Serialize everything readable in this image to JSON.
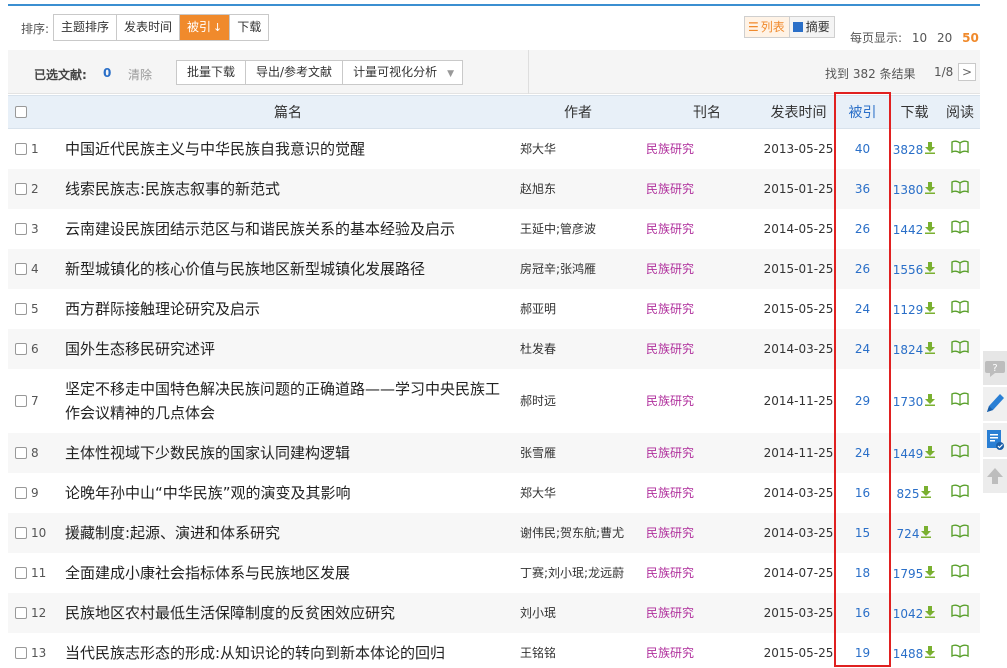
{
  "sortbar": {
    "label": "排序:",
    "options": [
      {
        "label": "主题排序"
      },
      {
        "label": "发表时间"
      },
      {
        "label": "被引",
        "arrow": "↓"
      },
      {
        "label": "下载"
      }
    ],
    "view_list": "列表",
    "view_abstract": "摘要",
    "perpage_label": "每页显示:",
    "perpage_options": [
      "10",
      "20",
      "50"
    ],
    "perpage_selected": "50"
  },
  "selbar": {
    "selected_label": "已选文献:",
    "selected_count": "0",
    "clear": "清除",
    "actions": [
      "批量下载",
      "导出/参考文献",
      "计量可视化分析"
    ],
    "result_count": "找到 382 条结果",
    "page_indicator": "1/8",
    "next": ">"
  },
  "table": {
    "headers": {
      "title": "篇名",
      "author": "作者",
      "journal": "刊名",
      "date": "发表时间",
      "cite": "被引",
      "download": "下载",
      "read": "阅读"
    },
    "rows": [
      {
        "num": "1",
        "title": "中国近代民族主义与中华民族自我意识的觉醒",
        "author": "郑大华",
        "journal": "民族研究",
        "date": "2013-05-25",
        "cite": "40",
        "download": "3828"
      },
      {
        "num": "2",
        "title": "线索民族志:民族志叙事的新范式",
        "author": "赵旭东",
        "journal": "民族研究",
        "date": "2015-01-25",
        "cite": "36",
        "download": "1380"
      },
      {
        "num": "3",
        "title": "云南建设民族团结示范区与和谐民族关系的基本经验及启示",
        "author": "王延中;管彦波",
        "journal": "民族研究",
        "date": "2014-05-25",
        "cite": "26",
        "download": "1442"
      },
      {
        "num": "4",
        "title": "新型城镇化的核心价值与民族地区新型城镇化发展路径",
        "author": "房冠辛;张鸿雁",
        "journal": "民族研究",
        "date": "2015-01-25",
        "cite": "26",
        "download": "1556"
      },
      {
        "num": "5",
        "title": "西方群际接触理论研究及启示",
        "author": "郝亚明",
        "journal": "民族研究",
        "date": "2015-05-25",
        "cite": "24",
        "download": "1129"
      },
      {
        "num": "6",
        "title": "国外生态移民研究述评",
        "author": "杜发春",
        "journal": "民族研究",
        "date": "2014-03-25",
        "cite": "24",
        "download": "1824"
      },
      {
        "num": "7",
        "title": "坚定不移走中国特色解决民族问题的正确道路——学习中央民族工作会议精神的几点体会",
        "author": "郝时远",
        "journal": "民族研究",
        "date": "2014-11-25",
        "cite": "29",
        "download": "1730"
      },
      {
        "num": "8",
        "title": "主体性视域下少数民族的国家认同建构逻辑",
        "author": "张雪雁",
        "journal": "民族研究",
        "date": "2014-11-25",
        "cite": "24",
        "download": "1449"
      },
      {
        "num": "9",
        "title": "论晚年孙中山“中华民族”观的演变及其影响",
        "author": "郑大华",
        "journal": "民族研究",
        "date": "2014-03-25",
        "cite": "16",
        "download": "825"
      },
      {
        "num": "10",
        "title": "援藏制度:起源、演进和体系研究",
        "author": "谢伟民;贺东航;曹尤",
        "journal": "民族研究",
        "date": "2014-03-25",
        "cite": "15",
        "download": "724"
      },
      {
        "num": "11",
        "title": "全面建成小康社会指标体系与民族地区发展",
        "author": "丁赛;刘小珉;龙远蔚",
        "journal": "民族研究",
        "date": "2014-07-25",
        "cite": "18",
        "download": "1795"
      },
      {
        "num": "12",
        "title": "民族地区农村最低生活保障制度的反贫困效应研究",
        "author": "刘小珉",
        "journal": "民族研究",
        "date": "2015-03-25",
        "cite": "16",
        "download": "1042"
      },
      {
        "num": "13",
        "title": "当代民族志形态的形成:从知识论的转向到新本体论的回归",
        "author": "王铭铭",
        "journal": "民族研究",
        "date": "2015-05-25",
        "cite": "19",
        "download": "1488"
      }
    ]
  },
  "colors": {
    "accent": "#f08a2c",
    "link_blue": "#2a6fc8",
    "journal_purple": "#b0309d",
    "highlight_red": "#e02020",
    "icon_green": "#5aa02c"
  },
  "icons": {
    "download": "download-icon",
    "read": "open-book-icon",
    "side": [
      "feedback-icon",
      "note-pen-icon",
      "collect-icon",
      "back-to-top-icon"
    ]
  }
}
